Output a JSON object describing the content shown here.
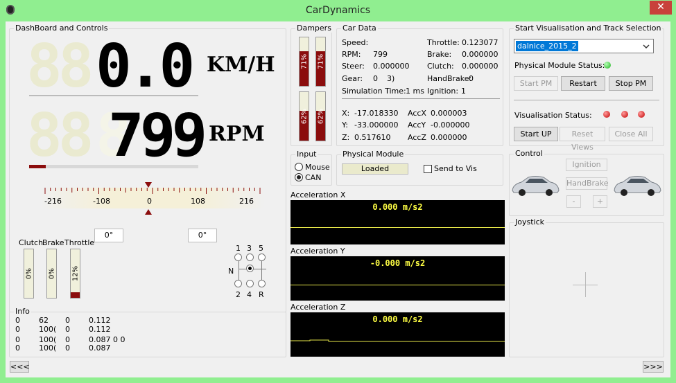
{
  "window": {
    "title": "CarDynamics",
    "close_glyph": "✕",
    "icon": "tire-icon"
  },
  "dashboard": {
    "group_label": "DashBoard and Controls",
    "speed_ghost": "88",
    "speed_value": "0.0",
    "speed_ghost_digit": "8",
    "speed_unit": "KM/H",
    "rpm_ghost": "88",
    "rpm_ghost_digit": "8",
    "rpm_value": "799",
    "rpm_unit": "RPM",
    "rpm_level_fraction": 0.1,
    "steer_ticks": [
      "-216",
      "-108",
      "0",
      "108",
      "216"
    ],
    "steer_left": "0°",
    "steer_right": "0°",
    "pedal_labels": {
      "clutch": "Clutch",
      "brake": "Brake",
      "throttle": "Throttle"
    },
    "pedals": {
      "clutch": "0%",
      "brake": "0%",
      "throttle": "12%"
    },
    "pedal_levels": {
      "clutch": 0,
      "brake": 0,
      "throttle": 0.12
    },
    "gear_labels": {
      "g1": "1",
      "g3": "3",
      "g5": "5",
      "n": "N",
      "g2": "2",
      "g4": "4",
      "r": "R"
    }
  },
  "info": {
    "label": "Info",
    "rows": [
      [
        "0",
        "62",
        "0",
        "0.112"
      ],
      [
        "0",
        "100(",
        "0",
        "0.112"
      ],
      [
        "0",
        "100(",
        "0",
        "0.087 0   0"
      ],
      [
        "0",
        "100(",
        "0",
        "0.087"
      ]
    ]
  },
  "dampers": {
    "label": "Dampers",
    "values": [
      "71%",
      "71%",
      "62%",
      "62%"
    ],
    "levels": [
      0.71,
      0.71,
      0.62,
      0.62
    ]
  },
  "car_data": {
    "label": "Car Data",
    "speed_label": "Speed:",
    "rpm_label": "RPM:",
    "rpm_value": "799",
    "steer_label": "Steer:",
    "steer_value": "0.000000",
    "gear_label": "Gear:",
    "gear_value": "0",
    "gear_extra": "3)",
    "sim_time_label": "Simulation Time:",
    "sim_time_value": "1 ms",
    "throttle_label": "Throttle:",
    "throttle_value": "0.123077",
    "brake_label": "Brake:",
    "brake_value": "0.000000",
    "clutch_label": "Clutch:",
    "clutch_value": "0.000000",
    "handbrake_label": "HandBrake:",
    "handbrake_value": "0",
    "ignition_label": "Ignition:",
    "ignition_value": "1",
    "x_label": "X:",
    "x_value": "-17.018330",
    "y_label": "Y:",
    "y_value": "-33.000000",
    "z_label": "Z:",
    "z_value": "0.517610",
    "accx_label": "AccX",
    "accx_value": "0.000003",
    "accy_label": "AccY",
    "accy_value": "-0.000000",
    "accz_label": "AccZ",
    "accz_value": "0.000000"
  },
  "input": {
    "label": "Input",
    "mouse": "Mouse",
    "can": "CAN",
    "selected": "CAN"
  },
  "physical_module": {
    "label": "Physical Module",
    "status": "Loaded",
    "send_to_vis": "Send to Vis"
  },
  "accel": {
    "x": {
      "label": "Acceleration X",
      "value": "0.000 m/s2"
    },
    "y": {
      "label": "Acceleration Y",
      "value": "-0.000 m/s2"
    },
    "z": {
      "label": "Acceleration Z",
      "value": "0.000 m/s2"
    }
  },
  "vis": {
    "label": "Start Visualisation and Track Selection",
    "track": "dalnice_2015_2",
    "pm_status_label": "Physical Module Status:",
    "start_pm": "Start PM",
    "restart": "Restart",
    "stop_pm": "Stop PM",
    "vis_status_label": "Visualisation Status:",
    "start_up": "Start UP",
    "reset_views": "Reset Views",
    "close_all": "Close All",
    "colors": {
      "ok": "#1fb11f",
      "error": "#c10000"
    }
  },
  "control": {
    "label": "Control",
    "ignition": "Ignition",
    "handbrake": "HandBrake",
    "minus": "-",
    "plus": "+"
  },
  "joystick": {
    "label": "Joystick"
  },
  "nav": {
    "prev": "<<<",
    "next": ">>>"
  }
}
